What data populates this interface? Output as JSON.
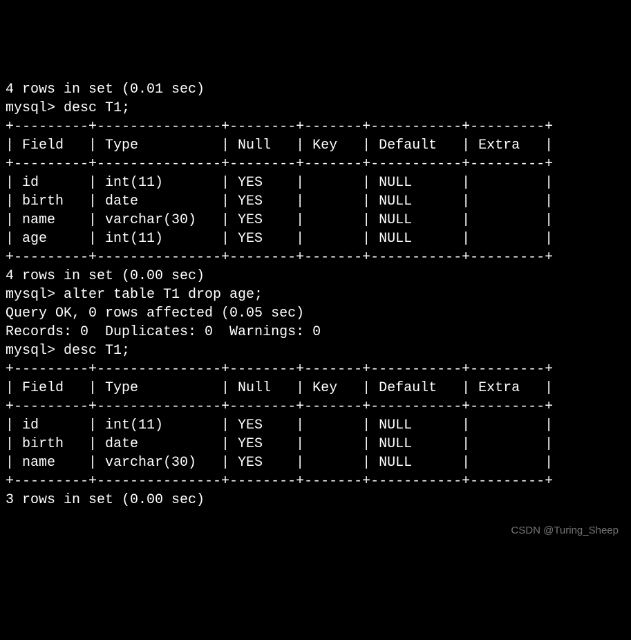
{
  "top_partial_line": "4 rows in set (0.01 sec)",
  "prompt": "mysql>",
  "commands": {
    "desc1": "desc T1;",
    "alter": "alter table T1 drop age;",
    "desc2": "desc T1;"
  },
  "alter_response": {
    "line1": "Query OK, 0 rows affected (0.05 sec)",
    "line2": "Records: 0  Duplicates: 0  Warnings: 0"
  },
  "table1": {
    "columns": [
      "Field",
      "Type",
      "Null",
      "Key",
      "Default",
      "Extra"
    ],
    "rows": [
      {
        "Field": "id",
        "Type": "int(11)",
        "Null": "YES",
        "Key": "",
        "Default": "NULL",
        "Extra": ""
      },
      {
        "Field": "birth",
        "Type": "date",
        "Null": "YES",
        "Key": "",
        "Default": "NULL",
        "Extra": ""
      },
      {
        "Field": "name",
        "Type": "varchar(30)",
        "Null": "YES",
        "Key": "",
        "Default": "NULL",
        "Extra": ""
      },
      {
        "Field": "age",
        "Type": "int(11)",
        "Null": "YES",
        "Key": "",
        "Default": "NULL",
        "Extra": ""
      }
    ],
    "footer": "4 rows in set (0.00 sec)"
  },
  "table2": {
    "columns": [
      "Field",
      "Type",
      "Null",
      "Key",
      "Default",
      "Extra"
    ],
    "rows": [
      {
        "Field": "id",
        "Type": "int(11)",
        "Null": "YES",
        "Key": "",
        "Default": "NULL",
        "Extra": ""
      },
      {
        "Field": "birth",
        "Type": "date",
        "Null": "YES",
        "Key": "",
        "Default": "NULL",
        "Extra": ""
      },
      {
        "Field": "name",
        "Type": "varchar(30)",
        "Null": "YES",
        "Key": "",
        "Default": "NULL",
        "Extra": ""
      }
    ],
    "footer": "3 rows in set (0.00 sec)"
  },
  "col_widths": {
    "Field": 7,
    "Type": 13,
    "Null": 6,
    "Key": 5,
    "Default": 9,
    "Extra": 7
  },
  "watermark": "CSDN @Turing_Sheep"
}
